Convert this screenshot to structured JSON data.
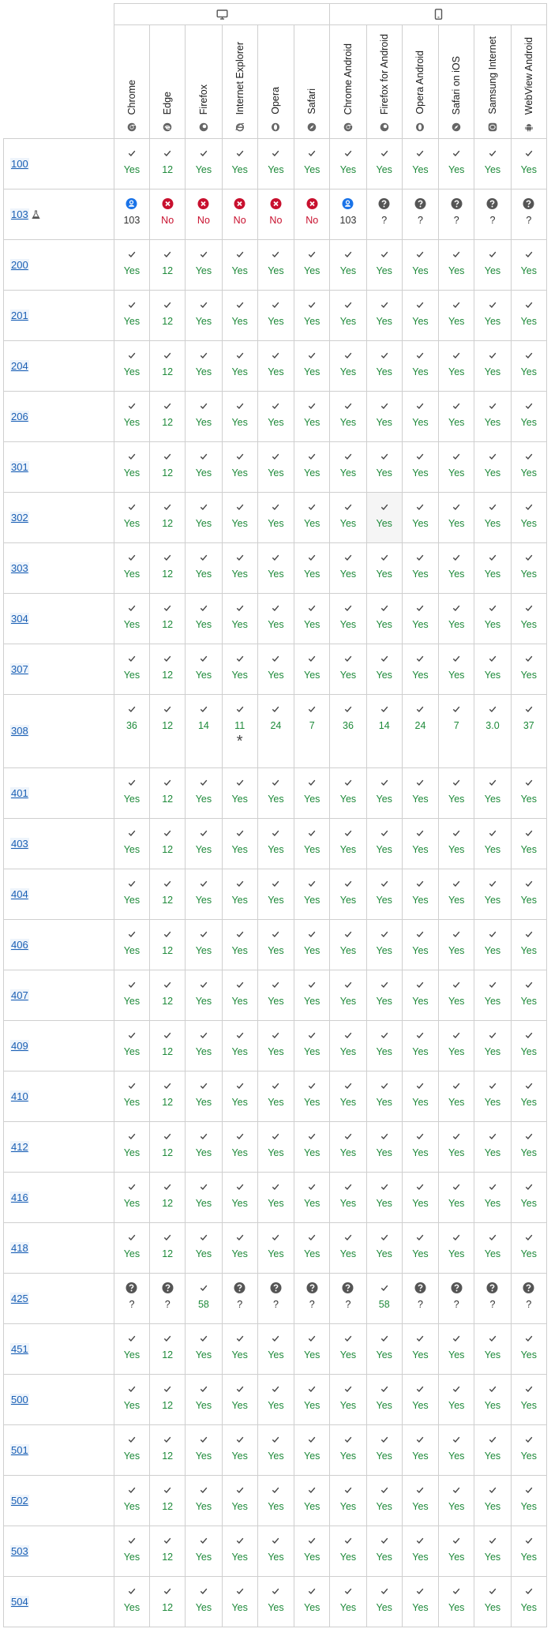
{
  "platforms": [
    {
      "key": "desktop",
      "icon": "desktop-icon",
      "span": 6
    },
    {
      "key": "mobile",
      "icon": "mobile-icon",
      "span": 6
    }
  ],
  "browsers": [
    {
      "name": "Chrome",
      "icon": "chrome-icon"
    },
    {
      "name": "Edge",
      "icon": "edge-icon"
    },
    {
      "name": "Firefox",
      "icon": "firefox-icon"
    },
    {
      "name": "Internet Explorer",
      "icon": "internet-explorer-icon"
    },
    {
      "name": "Opera",
      "icon": "opera-icon"
    },
    {
      "name": "Safari",
      "icon": "safari-icon"
    },
    {
      "name": "Chrome Android",
      "icon": "chrome-icon"
    },
    {
      "name": "Firefox for Android",
      "icon": "firefox-icon"
    },
    {
      "name": "Opera Android",
      "icon": "opera-icon"
    },
    {
      "name": "Safari on iOS",
      "icon": "safari-icon"
    },
    {
      "name": "Samsung Internet",
      "icon": "samsung-internet-icon"
    },
    {
      "name": "WebView Android",
      "icon": "android-icon"
    }
  ],
  "default_values": [
    "Yes",
    "12",
    "Yes",
    "Yes",
    "Yes",
    "Yes",
    "Yes",
    "Yes",
    "Yes",
    "Yes",
    "Yes",
    "Yes"
  ],
  "colors": {
    "yes": "#1e8a3a",
    "no": "#c8102e",
    "preview": "#1a73e8",
    "unknown": "#555555",
    "link": "#1a5fb4"
  },
  "rows": [
    {
      "code": "100"
    },
    {
      "code": "103",
      "experimental": true,
      "cells": [
        {
          "kind": "preview",
          "value": "103"
        },
        {
          "kind": "no",
          "value": "No"
        },
        {
          "kind": "no",
          "value": "No"
        },
        {
          "kind": "no",
          "value": "No"
        },
        {
          "kind": "no",
          "value": "No"
        },
        {
          "kind": "no",
          "value": "No"
        },
        {
          "kind": "preview",
          "value": "103"
        },
        {
          "kind": "unk",
          "value": "?"
        },
        {
          "kind": "unk",
          "value": "?"
        },
        {
          "kind": "unk",
          "value": "?"
        },
        {
          "kind": "unk",
          "value": "?"
        },
        {
          "kind": "unk",
          "value": "?"
        }
      ]
    },
    {
      "code": "200"
    },
    {
      "code": "201"
    },
    {
      "code": "204"
    },
    {
      "code": "206"
    },
    {
      "code": "301"
    },
    {
      "code": "302",
      "hover_col": 7
    },
    {
      "code": "303"
    },
    {
      "code": "304"
    },
    {
      "code": "307"
    },
    {
      "code": "308",
      "tall": true,
      "cells": [
        {
          "kind": "yes",
          "value": "36"
        },
        {
          "kind": "yes",
          "value": "12"
        },
        {
          "kind": "yes",
          "value": "14"
        },
        {
          "kind": "yes",
          "value": "11",
          "note": "*"
        },
        {
          "kind": "yes",
          "value": "24"
        },
        {
          "kind": "yes",
          "value": "7"
        },
        {
          "kind": "yes",
          "value": "36"
        },
        {
          "kind": "yes",
          "value": "14"
        },
        {
          "kind": "yes",
          "value": "24"
        },
        {
          "kind": "yes",
          "value": "7"
        },
        {
          "kind": "yes",
          "value": "3.0"
        },
        {
          "kind": "yes",
          "value": "37"
        }
      ]
    },
    {
      "code": "401"
    },
    {
      "code": "403"
    },
    {
      "code": "404"
    },
    {
      "code": "406"
    },
    {
      "code": "407"
    },
    {
      "code": "409"
    },
    {
      "code": "410"
    },
    {
      "code": "412"
    },
    {
      "code": "416"
    },
    {
      "code": "418"
    },
    {
      "code": "425",
      "cells": [
        {
          "kind": "unk",
          "value": "?"
        },
        {
          "kind": "unk",
          "value": "?"
        },
        {
          "kind": "yes",
          "value": "58"
        },
        {
          "kind": "unk",
          "value": "?"
        },
        {
          "kind": "unk",
          "value": "?"
        },
        {
          "kind": "unk",
          "value": "?"
        },
        {
          "kind": "unk",
          "value": "?"
        },
        {
          "kind": "yes",
          "value": "58"
        },
        {
          "kind": "unk",
          "value": "?"
        },
        {
          "kind": "unk",
          "value": "?"
        },
        {
          "kind": "unk",
          "value": "?"
        },
        {
          "kind": "unk",
          "value": "?"
        }
      ]
    },
    {
      "code": "451"
    },
    {
      "code": "500"
    },
    {
      "code": "501"
    },
    {
      "code": "502"
    },
    {
      "code": "503"
    },
    {
      "code": "504"
    }
  ]
}
